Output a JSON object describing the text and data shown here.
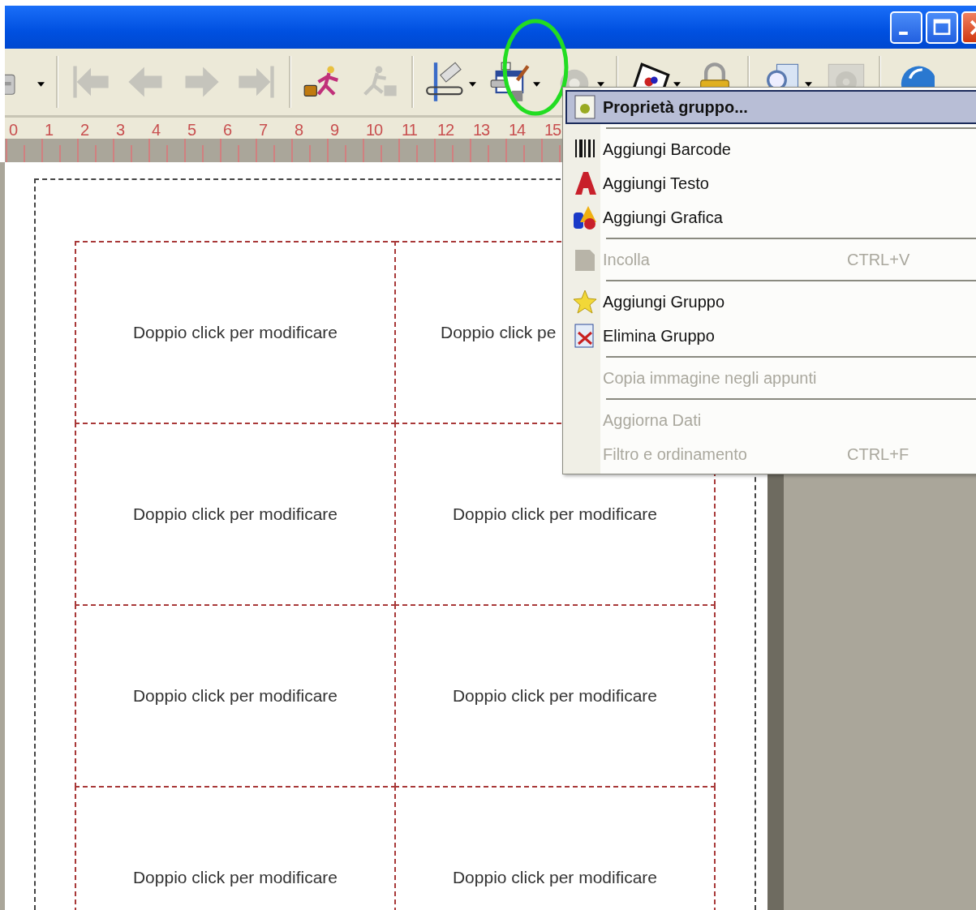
{
  "toolbar": {
    "buttons": [
      {
        "kind": "printer",
        "disabled": false,
        "dropdown": true
      },
      {
        "kind": "separator"
      },
      {
        "kind": "first",
        "disabled": true,
        "dropdown": false
      },
      {
        "kind": "previous",
        "disabled": true,
        "dropdown": false
      },
      {
        "kind": "next",
        "disabled": true,
        "dropdown": false
      },
      {
        "kind": "last",
        "disabled": true,
        "dropdown": false
      },
      {
        "kind": "separator"
      },
      {
        "kind": "run",
        "disabled": false,
        "dropdown": false
      },
      {
        "kind": "stop",
        "disabled": true,
        "dropdown": false
      },
      {
        "kind": "separator"
      },
      {
        "kind": "design",
        "disabled": false,
        "dropdown": true
      },
      {
        "kind": "group",
        "disabled": false,
        "dropdown": true
      },
      {
        "kind": "gear",
        "disabled": true,
        "dropdown": true
      },
      {
        "kind": "separator"
      },
      {
        "kind": "image",
        "disabled": false,
        "dropdown": true
      },
      {
        "kind": "lock",
        "disabled": false,
        "dropdown": false
      },
      {
        "kind": "separator"
      },
      {
        "kind": "preview",
        "disabled": false,
        "dropdown": true
      },
      {
        "kind": "settings",
        "disabled": true,
        "dropdown": false
      },
      {
        "kind": "separator"
      },
      {
        "kind": "globe",
        "disabled": false,
        "dropdown": false
      }
    ]
  },
  "ruler": {
    "numbers": [
      "0",
      "1",
      "2",
      "3",
      "4",
      "5",
      "6",
      "7",
      "8",
      "9",
      "10",
      "11",
      "12",
      "13",
      "14",
      "15"
    ]
  },
  "labels": [
    "Doppio click per modificare",
    "Doppio click pe",
    "Doppio click per modificare",
    "Doppio click per modificare",
    "Doppio click per modificare",
    "Doppio click per modificare",
    "Doppio click per modificare",
    "Doppio click per modificare"
  ],
  "context_menu": {
    "items": [
      {
        "kind": "item",
        "label": "Proprietà gruppo...",
        "selected": true,
        "disabled": false
      },
      {
        "kind": "separator"
      },
      {
        "kind": "item",
        "label": "Aggiungi Barcode",
        "selected": false,
        "disabled": false
      },
      {
        "kind": "item",
        "label": "Aggiungi Testo",
        "selected": false,
        "disabled": false
      },
      {
        "kind": "item",
        "label": "Aggiungi Grafica",
        "selected": false,
        "disabled": false
      },
      {
        "kind": "separator"
      },
      {
        "kind": "item",
        "label": "Incolla",
        "shortcut": "CTRL+V",
        "selected": false,
        "disabled": true
      },
      {
        "kind": "separator"
      },
      {
        "kind": "item",
        "label": "Aggiungi Gruppo",
        "selected": false,
        "disabled": false
      },
      {
        "kind": "item",
        "label": "Elimina Gruppo",
        "selected": false,
        "disabled": false
      },
      {
        "kind": "separator"
      },
      {
        "kind": "item",
        "label": "Copia immagine negli appunti",
        "selected": false,
        "disabled": true
      },
      {
        "kind": "separator"
      },
      {
        "kind": "item",
        "label": "Aggiorna Dati",
        "selected": false,
        "disabled": true
      },
      {
        "kind": "item",
        "label": "Filtro e ordinamento",
        "shortcut": "CTRL+F",
        "selected": false,
        "disabled": true
      }
    ]
  }
}
